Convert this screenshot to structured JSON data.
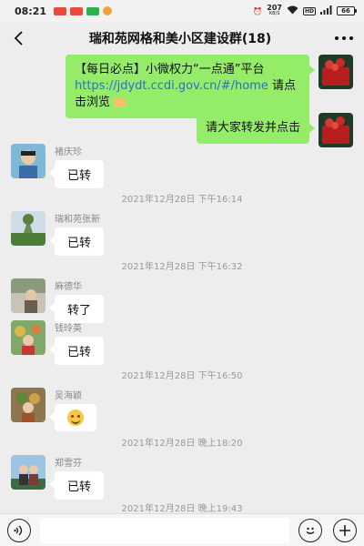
{
  "status_bar": {
    "time": "08:21",
    "net_speed_value": "207",
    "net_speed_unit": "KB/S",
    "hd_label": "HD",
    "battery": "66"
  },
  "header": {
    "title": "瑞和苑网格和美小区建设群(18)",
    "back_icon": "chevron-left-icon",
    "more_icon": "more-dots-icon"
  },
  "messages": {
    "out1_text_a": "【每日必点】小微权力“一点通”平台",
    "out1_link": "https://jdydt.ccdi.gov.cn/#/home",
    "out1_text_b": " 请点击浏览",
    "out2_text": "请大家转发并点击",
    "in1_sender": "褚庆珍",
    "in1_text": "已转",
    "ts1": "2021年12月28日 下午16:14",
    "in2_sender": "瑞和苑张新",
    "in2_text": "已转",
    "ts2": "2021年12月28日 下午16:32",
    "in3_sender": "麻德华",
    "in3_text": "转了",
    "in4_sender": "钱玲英",
    "in4_text": "已转",
    "ts3": "2021年12月28日 下午16:50",
    "in5_sender": "吴海颖",
    "ts4": "2021年12月28日 晚上18:20",
    "in6_sender": "郑雪芬",
    "in6_text": "已转",
    "ts5": "2021年12月28日 晚上19:43"
  },
  "input_bar": {
    "voice_icon": "voice-icon",
    "emoji_icon": "emoji-icon",
    "plus_icon": "plus-icon"
  },
  "colors": {
    "outgoing_bubble": "#95ec69",
    "incoming_bubble": "#ffffff",
    "background": "#ededed",
    "link": "#2b6cd8"
  }
}
